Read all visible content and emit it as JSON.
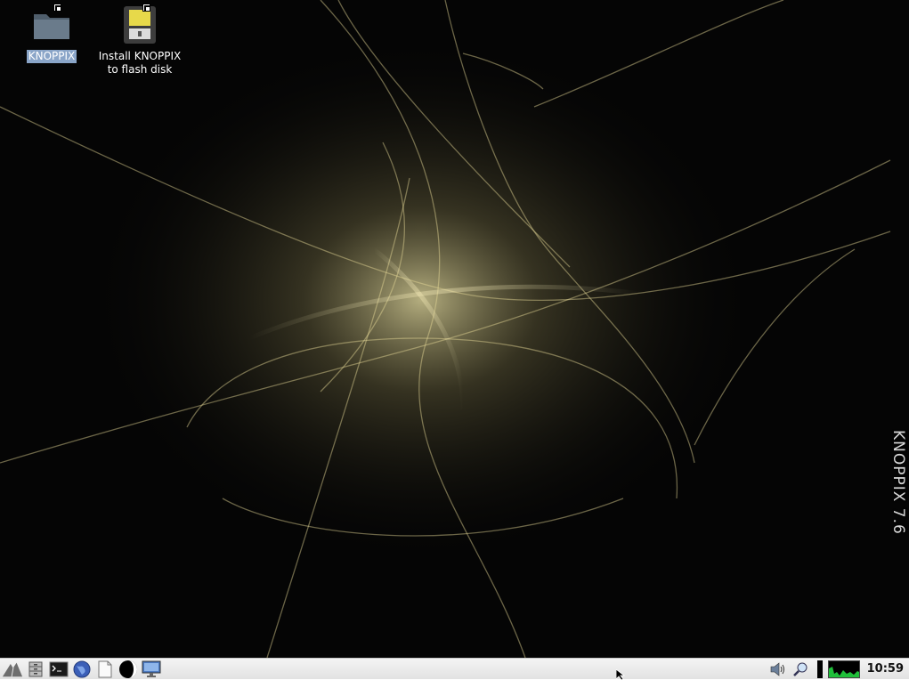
{
  "desktop": {
    "icons": [
      {
        "label": "KNOPPIX",
        "icon": "folder-icon",
        "selected": true
      },
      {
        "label": "Install KNOPPIX\nto flash disk",
        "icon": "flash-disk-icon",
        "selected": false
      }
    ],
    "version_label": "KNOPPIX 7.6"
  },
  "taskbar": {
    "launchers": [
      {
        "name": "start-menu-button",
        "icon": "knoppix-logo-icon"
      },
      {
        "name": "file-manager-button",
        "icon": "file-cabinet-icon"
      },
      {
        "name": "terminal-button",
        "icon": "terminal-icon"
      },
      {
        "name": "web-browser-button",
        "icon": "globe-icon"
      },
      {
        "name": "text-editor-button",
        "icon": "document-icon"
      },
      {
        "name": "media-button",
        "icon": "moon-icon"
      },
      {
        "name": "show-desktop-button",
        "icon": "monitor-icon"
      }
    ],
    "tray": {
      "volume_icon": "speaker-icon",
      "magnifier_icon": "magnifier-icon",
      "cpu_monitor": "cpu-graph"
    },
    "clock": "10:59"
  },
  "colors": {
    "wallpaper_base": "#050505",
    "wallpaper_glow": "#e8e0a0",
    "taskbar_bg": "#ececec",
    "selection": "#8aa5c8",
    "cpu_graph": "#1fbf3a"
  }
}
